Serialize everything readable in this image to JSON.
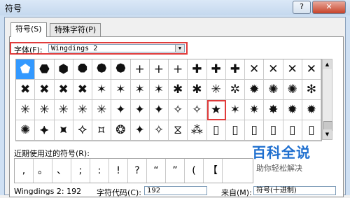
{
  "window": {
    "title": "符号",
    "help_label": "?",
    "close_label": "✕"
  },
  "tabs": [
    {
      "label": "符号(S)",
      "active": true
    },
    {
      "label": "特殊字符(P)",
      "active": false
    }
  ],
  "font": {
    "label": "字体(F):",
    "value": "Wingdings 2"
  },
  "symbols": [
    [
      "⬟",
      "⬣",
      "⬢",
      "⯃",
      "⯄",
      "⯄",
      "+",
      "+",
      "+",
      "✚",
      "✚",
      "✚",
      "✕",
      "✕",
      "✕",
      "✕"
    ],
    [
      "✖",
      "✖",
      "✖",
      "✖",
      "✶",
      "✶",
      "✶",
      "✶",
      "✱",
      "✱",
      "✳",
      "✲",
      "✹",
      "✺",
      "✺",
      "✻"
    ],
    [
      "✳",
      "✳",
      "✳",
      "✳",
      "✳",
      "✦",
      "✦",
      "✦",
      "✧",
      "✧",
      "★",
      "✶",
      "✷",
      "✸",
      "✹",
      "✹"
    ],
    [
      "✺",
      "⯌",
      "⯍",
      "⯎",
      "⯏",
      "❂",
      "✦",
      "✧",
      "⧖",
      "⁂",
      "▯",
      "▯",
      "▯",
      "▯",
      "▯",
      "▯"
    ]
  ],
  "recent": {
    "label": "近期使用过的符号(R):",
    "items": [
      ",",
      "。",
      "、",
      ";",
      ":",
      "!",
      "?",
      "“",
      "”",
      "(",
      "【"
    ]
  },
  "bottom": {
    "code_name": "Wingdings 2: 192",
    "char_code_label": "字符代码(C):",
    "char_code_value": "192",
    "from_label": "来自(M):",
    "from_value": "符号(十进制)"
  },
  "watermark": {
    "title": "百科全说",
    "subtitle": "助你轻松解决"
  }
}
